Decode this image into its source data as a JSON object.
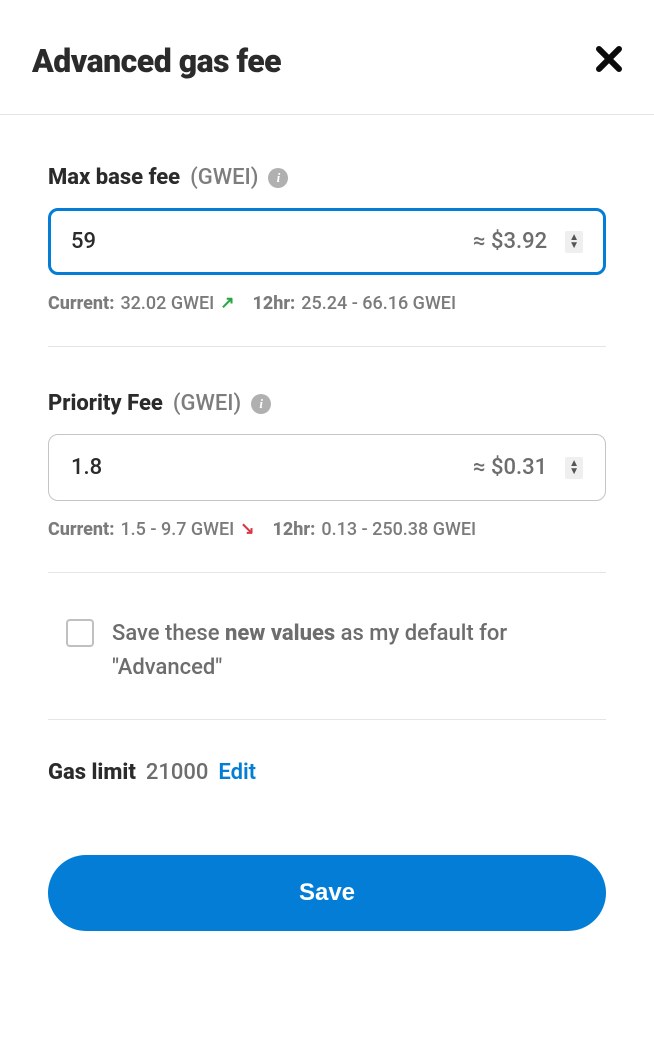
{
  "header": {
    "title": "Advanced gas fee"
  },
  "maxBaseFee": {
    "label": "Max base fee",
    "unit": "(GWEI)",
    "value": "59",
    "approx": "≈ $3.92",
    "currentLabel": "Current:",
    "currentValue": "32.02 GWEI",
    "twelveHrLabel": "12hr:",
    "twelveHrValue": "25.24 - 66.16 GWEI"
  },
  "priorityFee": {
    "label": "Priority Fee",
    "unit": "(GWEI)",
    "value": "1.8",
    "approx": "≈ $0.31",
    "currentLabel": "Current:",
    "currentValue": "1.5 - 9.7 GWEI",
    "twelveHrLabel": "12hr:",
    "twelveHrValue": "0.13 - 250.38 GWEI"
  },
  "saveDefault": {
    "textPrefix": "Save these ",
    "textBold": "new values",
    "textSuffix": " as my default for \"Advanced\""
  },
  "gasLimit": {
    "label": "Gas limit",
    "value": "21000",
    "editLabel": "Edit"
  },
  "saveButton": {
    "label": "Save"
  }
}
